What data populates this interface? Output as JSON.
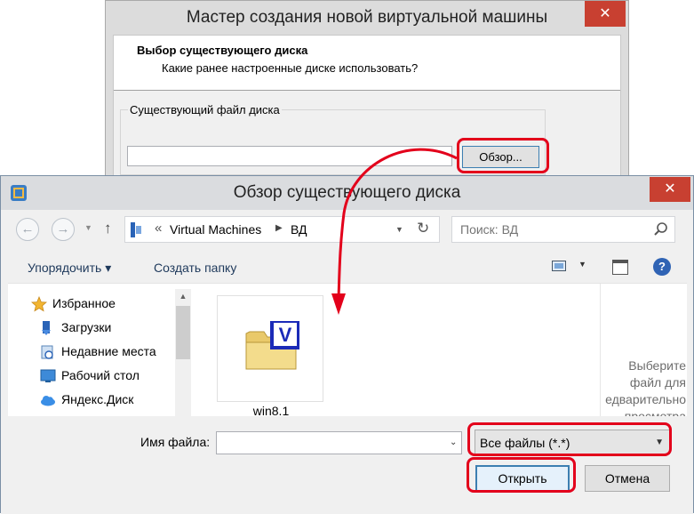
{
  "wizard": {
    "title": "Мастер создания новой виртуальной машины",
    "close_glyph": "✕",
    "header_title": "Выбор существующего диска",
    "header_subtitle": "Какие ранее настроенные диске использовать?",
    "group_label": "Существующий файл диска",
    "disk_path_value": "",
    "browse_label": "Обзор..."
  },
  "dialog": {
    "title": "Обзор существующего диска",
    "close_glyph": "✕",
    "nav": {
      "back_glyph": "←",
      "forward_glyph": "→",
      "up_glyph": "↑",
      "breadcrumb_prefix": "«",
      "breadcrumb": [
        "Virtual Machines",
        "ВД"
      ],
      "breadcrumb_separator": "▶",
      "refresh_glyph": "↻",
      "search_placeholder": "Поиск: ВД"
    },
    "toolbar": {
      "organize": "Упорядочить ▾",
      "new_folder": "Создать папку",
      "help": "?"
    },
    "sidebar": {
      "items": [
        {
          "label": "Избранное",
          "icon": "star-icon"
        },
        {
          "label": "Загрузки",
          "icon": "downloads-icon"
        },
        {
          "label": "Недавние места",
          "icon": "recent-places-icon"
        },
        {
          "label": "Рабочий стол",
          "icon": "desktop-icon"
        },
        {
          "label": "Яндекс.Диск",
          "icon": "cloud-icon"
        }
      ]
    },
    "files": [
      {
        "name": "win8.1",
        "icon": "vbox-folder-icon"
      }
    ],
    "preview_lines": [
      "Выберите",
      "файл для",
      "едварительно",
      "просмотра"
    ],
    "filename_label": "Имя файла:",
    "filename_value": "",
    "filter_value": "Все файлы (*.*)",
    "open_label": "Открыть",
    "cancel_label": "Отмена"
  },
  "colors": {
    "highlight": "#e3001b",
    "close_button": "#c84031",
    "primary_border": "#3c7fb1"
  }
}
